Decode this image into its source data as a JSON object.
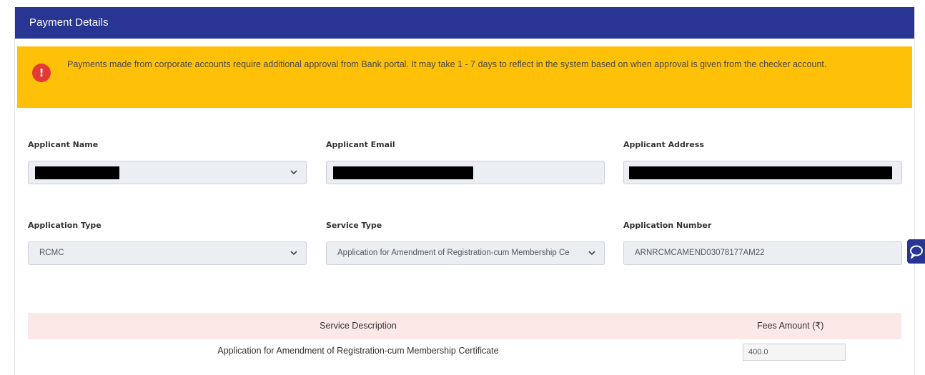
{
  "panel": {
    "title": "Payment Details"
  },
  "alert": {
    "icon": "exclamation-icon",
    "text": "Payments made from corporate accounts require additional approval from Bank portal. It may take 1 - 7 days to reflect in the system based on when approval is given from the checker account."
  },
  "fields": {
    "applicant_name": {
      "label": "Applicant Name",
      "value": ""
    },
    "applicant_email": {
      "label": "Applicant Email",
      "value": ""
    },
    "applicant_address": {
      "label": "Applicant Address",
      "value": ""
    },
    "application_type": {
      "label": "Application Type",
      "value": "RCMC"
    },
    "service_type": {
      "label": "Service Type",
      "value": "Application for Amendment of Registration-cum Membership Ce"
    },
    "application_number": {
      "label": "Application Number",
      "value": "ARNRCMCAMEND03078177AM22"
    }
  },
  "service_table": {
    "headers": [
      "Service Description",
      "Fees Amount (₹)"
    ],
    "rows": [
      {
        "description": "Application for Amendment of Registration-cum Membership Certificate",
        "fee": "400.0"
      }
    ]
  },
  "colors": {
    "header_bg": "#283593",
    "alert_bg": "#ffc107",
    "alert_icon": "#e53935",
    "table_header_bg": "#fde8e8"
  },
  "icons": {
    "chat": "chat-icon",
    "dropdown": "chevron-down-icon"
  }
}
